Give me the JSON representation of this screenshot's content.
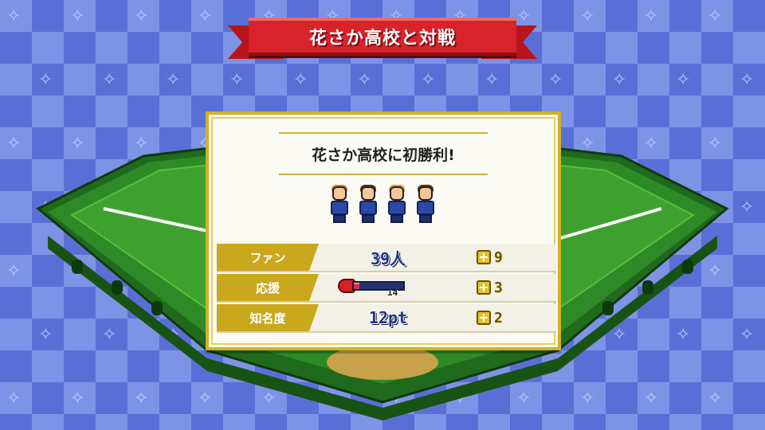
{
  "title": "花さか高校と対戦",
  "result": {
    "headline": "花さか高校に初勝利!",
    "players": [
      {
        "name": "player-1",
        "hair": "#c98a3a"
      },
      {
        "name": "player-2",
        "hair": "#4a3424"
      },
      {
        "name": "player-3",
        "hair": "#d9a64e"
      },
      {
        "name": "player-4",
        "hair": "#5a3a22"
      }
    ],
    "stats": [
      {
        "label": "ファン",
        "value": "39人",
        "bonus": "9"
      },
      {
        "label": "応援",
        "gauge_level": 0.12,
        "gauge_value": "14",
        "bonus": "3"
      },
      {
        "label": "知名度",
        "value": "12pt",
        "bonus": "2"
      }
    ]
  },
  "colors": {
    "ribbon": "#d7232c",
    "panel_border": "#d2b226",
    "label_bg": "#c9a81d",
    "field_green": "#3ea12f",
    "background_checker": "#5a6fd6"
  }
}
